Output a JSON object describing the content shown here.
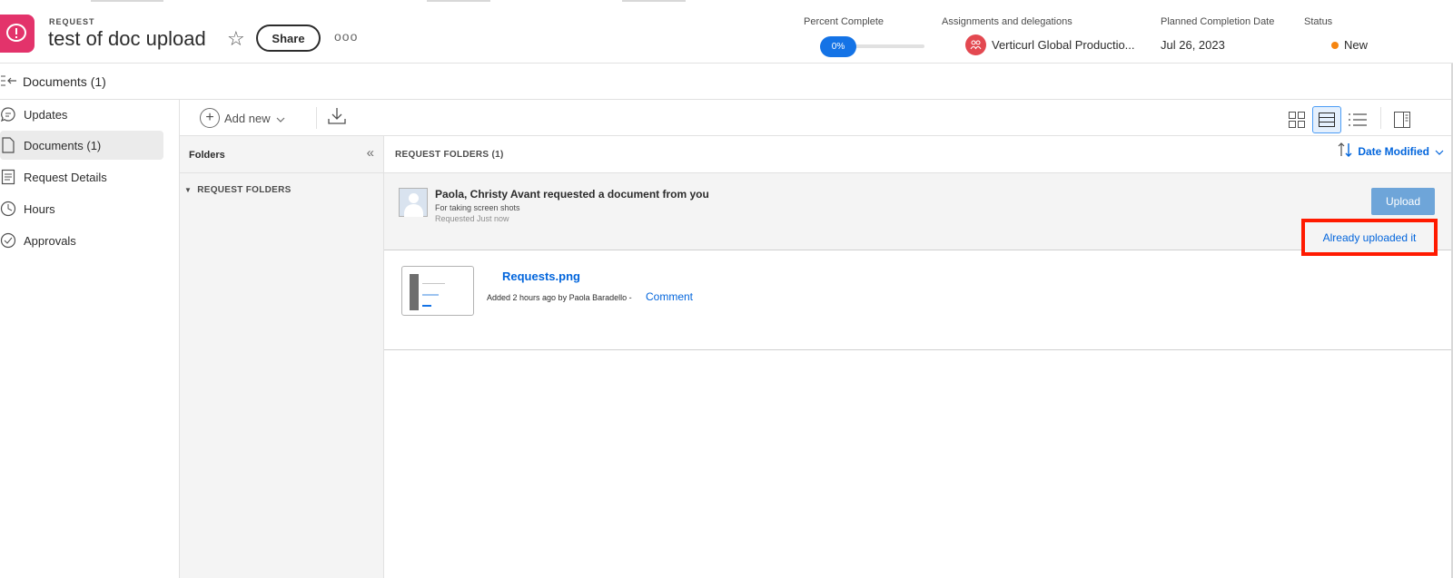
{
  "header": {
    "type_label": "REQUEST",
    "title": "test of doc upload",
    "share_label": "Share",
    "more_label": "ooo",
    "percent_complete_label": "Percent Complete",
    "percent_complete_value": "0%",
    "percent_complete_fraction": 0,
    "assignments_label": "Assignments and delegations",
    "assignee_name": "Verticurl Global Productio...",
    "planned_completion_label": "Planned Completion Date",
    "planned_completion_value": "Jul 26, 2023",
    "status_label": "Status",
    "status_value": "New",
    "status_color": "#f68511",
    "brand_color": "#e3336b"
  },
  "docbar": {
    "title": "Documents (1)"
  },
  "sidebar": {
    "items": [
      {
        "label": "Updates",
        "icon": "chat-bubble-icon"
      },
      {
        "label": "Documents (1)",
        "icon": "document-icon",
        "active": true
      },
      {
        "label": "Request Details",
        "icon": "details-icon"
      },
      {
        "label": "Hours",
        "icon": "clock-icon"
      },
      {
        "label": "Approvals",
        "icon": "checkmark-circle-icon"
      }
    ]
  },
  "toolbar": {
    "add_new_label": "Add new"
  },
  "folders": {
    "title": "Folders",
    "tree_item": "REQUEST FOLDERS"
  },
  "main": {
    "section_title": "REQUEST FOLDERS (1)",
    "sort_label": "Date Modified",
    "request": {
      "who": "Paola, Christy Avant requested a document from you",
      "description": "For taking screen shots",
      "when": "Requested Just now",
      "upload_label": "Upload",
      "already_label": "Already uploaded it"
    },
    "document": {
      "name": "Requests.png",
      "added": "Added 2 hours ago by Paola Baradello -",
      "comment_label": "Comment"
    }
  },
  "colors": {
    "accent": "#0265dc",
    "highlight_box": "#ff1a00"
  }
}
